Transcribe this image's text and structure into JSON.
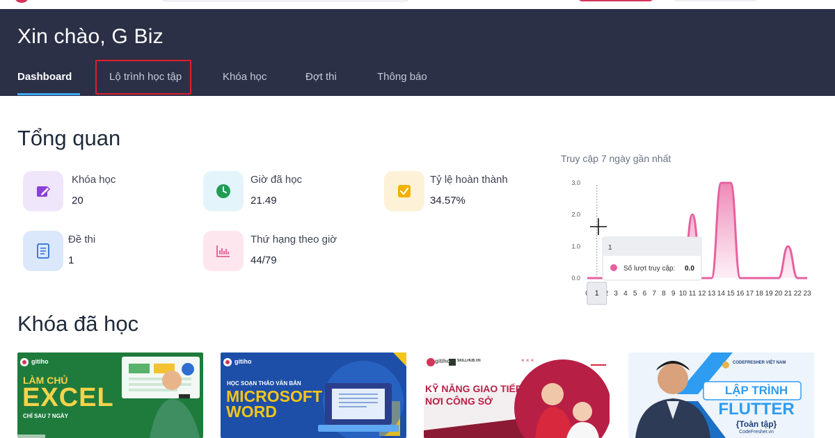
{
  "page": {
    "greeting": "Xin chào, G Biz",
    "tabs": [
      {
        "label": "Dashboard",
        "active": true
      },
      {
        "label": "Lộ trình học tập",
        "active": false
      },
      {
        "label": "Khóa học",
        "active": false
      },
      {
        "label": "Đợt thi",
        "active": false
      },
      {
        "label": "Thông báo",
        "active": false
      }
    ]
  },
  "overview": {
    "title": "Tổng quan",
    "stats": [
      {
        "label": "Khóa học",
        "value": "20",
        "icon": "edit-icon",
        "bg": "#efe6fb",
        "fg": "#8c3fd9"
      },
      {
        "label": "Giờ đã học",
        "value": "21.49",
        "icon": "clock-icon",
        "bg": "#e4f4fb",
        "fg": "#1f9d55"
      },
      {
        "label": "Tỷ lệ hoàn thành",
        "value": "34.57%",
        "icon": "checkbox-icon",
        "bg": "#fdf1d8",
        "fg": "#f2b200"
      },
      {
        "label": "Đề thi",
        "value": "1",
        "icon": "document-icon",
        "bg": "#dbe8fb",
        "fg": "#2f6fd0"
      },
      {
        "label": "Thứ hạng theo giờ",
        "value": "44/79",
        "icon": "bar-chart-icon",
        "bg": "#fde6ee",
        "fg": "#e04a85"
      }
    ]
  },
  "chart_data": {
    "type": "area",
    "title": "Truy cập 7 ngày gần nhất",
    "x": [
      0,
      1,
      2,
      3,
      4,
      5,
      6,
      7,
      8,
      9,
      10,
      11,
      12,
      13,
      14,
      15,
      16,
      17,
      18,
      19,
      20,
      21,
      22,
      23
    ],
    "tick_labels": [
      "0",
      "1",
      "2",
      "3",
      "4",
      "5",
      "6",
      "7",
      "8",
      "9",
      "10",
      "11",
      "12",
      "13",
      "14",
      "15",
      "16",
      "17",
      "18",
      "19",
      "20",
      "21",
      "22",
      "23"
    ],
    "series": [
      {
        "name": "Số lượt truy cập",
        "values": [
          0,
          0,
          0,
          0,
          0,
          0,
          0,
          0,
          0,
          0,
          0,
          2,
          0,
          0,
          3,
          3,
          0,
          0,
          0,
          0,
          0,
          1,
          0,
          0
        ]
      }
    ],
    "y_ticks": [
      "0.0",
      "1.0",
      "2.0",
      "3.0"
    ],
    "ylim": [
      0,
      3
    ],
    "tooltip": {
      "x_label": "1",
      "series_name": "Số lượt truy cập:",
      "value": "0.0",
      "hover_index": 1
    },
    "line_color": "#e8609e"
  },
  "courses": {
    "title": "Khóa đã học",
    "cards": [
      {
        "brand": "gitiho",
        "top_line": "LÀM CHỦ",
        "main": "EXCEL",
        "sub": "CHỈ SAU 7 NGÀY",
        "bg": "#1e7b3c"
      },
      {
        "brand": "gitiho",
        "top_line": "HỌC SOẠN THẢO VĂN BẢN",
        "main": "MICROSOFT",
        "main2": "WORD",
        "bg": "#1d4fa8"
      },
      {
        "brand": "gitiho",
        "brand2": "SKILLHUB.VN",
        "main": "KỸ NĂNG GIAO TIẾP",
        "main2": "NƠI CÔNG SỞ",
        "bg": "#8c1a35"
      },
      {
        "brand": "CODEFRESHER VIỆT NAM",
        "top_line": "LẬP TRÌNH",
        "main": "FLUTTER",
        "sub": "{Toàn tập}",
        "foot": "CodeFresher.vn",
        "bg": "#e9f1fb"
      }
    ]
  }
}
